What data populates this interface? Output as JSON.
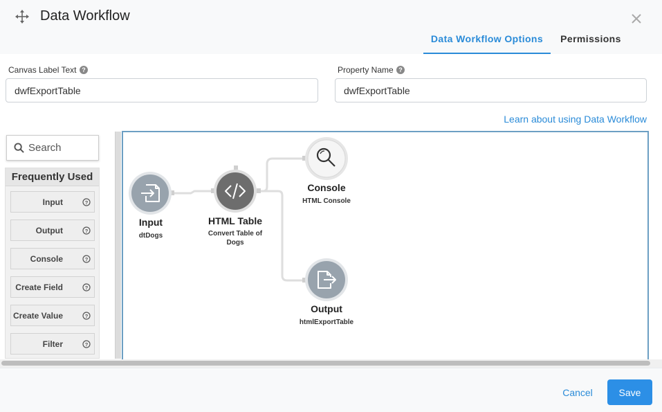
{
  "dialog": {
    "title": "Data Workflow",
    "tabs": [
      {
        "label": "Data Workflow Options",
        "active": true
      },
      {
        "label": "Permissions",
        "active": false
      }
    ]
  },
  "fields": {
    "canvas_label": {
      "label": "Canvas Label Text",
      "value": "dwfExportTable"
    },
    "property_name": {
      "label": "Property Name",
      "value": "dwfExportTable"
    }
  },
  "learn_link": "Learn about using Data Workflow",
  "sidebar": {
    "search_placeholder": "Search",
    "section_title": "Frequently Used",
    "items": [
      {
        "label": "Input"
      },
      {
        "label": "Output"
      },
      {
        "label": "Console"
      },
      {
        "label": "Create Field"
      },
      {
        "label": "Create Value"
      },
      {
        "label": "Filter"
      }
    ]
  },
  "nodes": {
    "input": {
      "title": "Input",
      "subtitle": "dtDogs",
      "icon": "input-arrow-icon"
    },
    "html_table": {
      "title": "HTML Table",
      "subtitle": "Convert Table of Dogs",
      "icon": "code-icon"
    },
    "console": {
      "title": "Console",
      "subtitle": "HTML Console",
      "icon": "magnifier-icon"
    },
    "output": {
      "title": "Output",
      "subtitle": "htmlExportTable",
      "icon": "output-document-icon"
    }
  },
  "footer": {
    "cancel_label": "Cancel",
    "save_label": "Save"
  },
  "colors": {
    "accent": "#2a8bd8",
    "node_grey": "#98a3ad",
    "node_dark": "#6d6d6d",
    "canvas_border": "#6c9fc3"
  }
}
